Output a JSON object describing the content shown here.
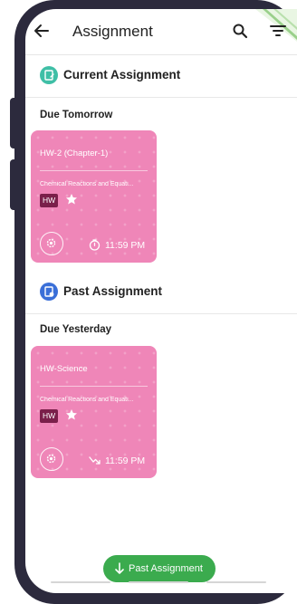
{
  "header": {
    "title": "Assignment",
    "back_icon": "arrow-left-icon",
    "search_icon": "search-icon",
    "filter_icon": "filter-icon"
  },
  "sections": [
    {
      "title": "Current Assignment",
      "icon": "edit-document-icon",
      "icon_color": "#3fbfa6",
      "due_label": "Due Tomorrow",
      "card": {
        "title": "HW-2 (Chapter-1)",
        "subject": "Chemical Reactions and Equati...",
        "tag": "HW",
        "time": "11:59 PM",
        "time_icon": "timer-icon"
      }
    },
    {
      "title": "Past Assignment",
      "icon": "document-history-icon",
      "icon_color": "#3a6fd8",
      "due_label": "Due Yesterday",
      "card": {
        "title": "HW-Science",
        "subject": "Chemical Reactions and Equati...",
        "tag": "HW",
        "time": "11:59 PM",
        "time_icon": "trend-down-icon"
      }
    }
  ],
  "footer_button": {
    "label": "Past Assignment",
    "icon": "arrow-down-icon",
    "color": "#3bab4e"
  },
  "colors": {
    "card": "#ef86b8",
    "tag": "#7a1f4a",
    "frame": "#2c2a3d"
  }
}
